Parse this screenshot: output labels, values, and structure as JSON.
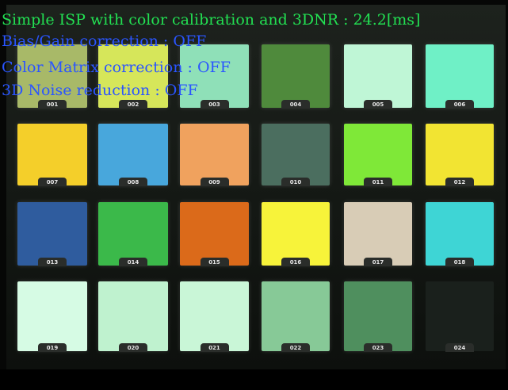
{
  "overlay": {
    "title_text": "Simple ISP with color calibration and 3DNR : 24.2[ms]",
    "bias_gain_text": "Bias/Gain correction : OFF",
    "color_matrix_text": "Color Matrix correction : OFF",
    "noise_reduction_text": "3D Noise reduction : OFF",
    "title_color": "#22e052",
    "status_color": "#2a55ff"
  },
  "patches": [
    {
      "label": "001",
      "color": "#a8b968"
    },
    {
      "label": "002",
      "color": "#d6e65a"
    },
    {
      "label": "003",
      "color": "#8fe0b8"
    },
    {
      "label": "004",
      "color": "#4f8a3c"
    },
    {
      "label": "005",
      "color": "#bff6d6"
    },
    {
      "label": "006",
      "color": "#6ff0c6"
    },
    {
      "label": "007",
      "color": "#f4cf2a"
    },
    {
      "label": "008",
      "color": "#48a7dc"
    },
    {
      "label": "009",
      "color": "#f0a25e"
    },
    {
      "label": "010",
      "color": "#4b6e5f"
    },
    {
      "label": "011",
      "color": "#7fe838"
    },
    {
      "label": "012",
      "color": "#f2e432"
    },
    {
      "label": "013",
      "color": "#2f5c9e"
    },
    {
      "label": "014",
      "color": "#3bb94a"
    },
    {
      "label": "015",
      "color": "#db6a1a"
    },
    {
      "label": "016",
      "color": "#f7f33a"
    },
    {
      "label": "017",
      "color": "#d8ccb6"
    },
    {
      "label": "018",
      "color": "#3ed5d5"
    },
    {
      "label": "019",
      "color": "#d6fbe4"
    },
    {
      "label": "020",
      "color": "#bff2cf"
    },
    {
      "label": "021",
      "color": "#c9f6d7"
    },
    {
      "label": "022",
      "color": "#87c997"
    },
    {
      "label": "023",
      "color": "#4f8f5e"
    },
    {
      "label": "024",
      "color": "#1a201c"
    }
  ]
}
